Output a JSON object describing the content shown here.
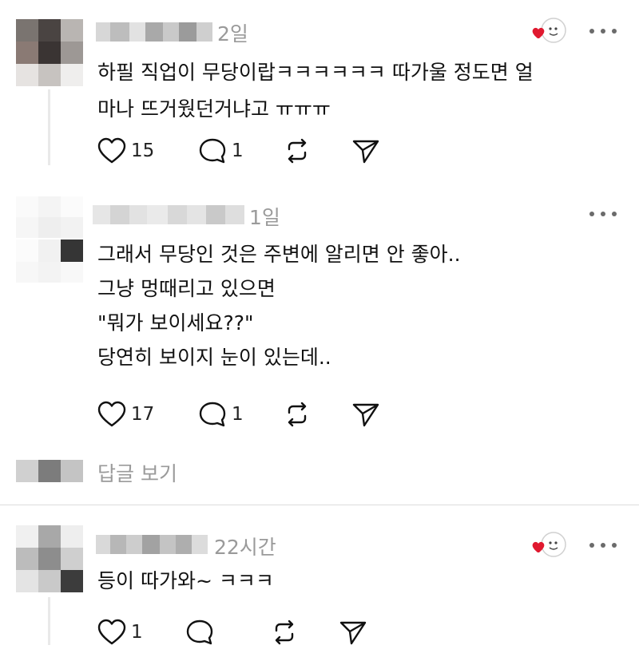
{
  "comments": [
    {
      "time": "2일",
      "text_lines": [
        "하필 직업이 무당이랍ㅋㅋㅋㅋㅋㅋ 따가울 정도면 얼",
        "마나 뜨거웠던거냐고 ㅠㅠㅠ"
      ],
      "likes": "15",
      "replies": "1",
      "liked_by_author": true
    },
    {
      "time": "1일",
      "text_lines": [
        "그래서 무당인 것은 주변에 알리면 안 좋아..",
        "그냥 멍때리고 있으면",
        "\"뭐가 보이세요??\"",
        "당연히 보이지 눈이 있는데.."
      ],
      "likes": "17",
      "replies": "1",
      "liked_by_author": false
    },
    {
      "time": "22시간",
      "text_lines": [
        "등이 따가와~ ㅋㅋㅋ"
      ],
      "likes": "1",
      "replies": "",
      "liked_by_author": true
    }
  ],
  "view_replies_label": "답글 보기",
  "icons": {
    "like": "heart-icon",
    "reply": "comment-icon",
    "repost": "repost-icon",
    "share": "send-icon",
    "more": "more-icon"
  },
  "colors": {
    "heart_red": "#e0192f",
    "muted_text": "#9a9a9a"
  }
}
